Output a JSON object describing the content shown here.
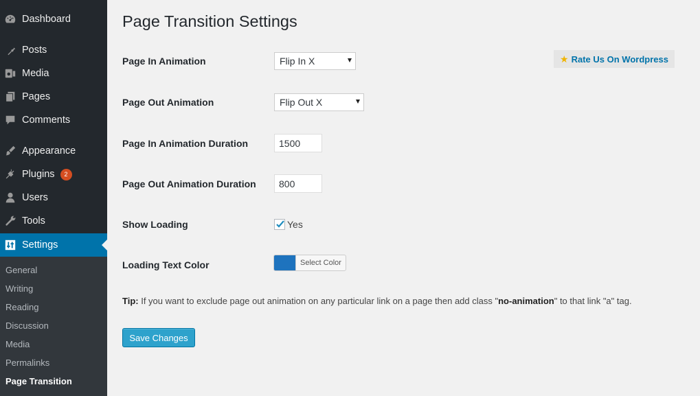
{
  "sidebar": {
    "items": [
      {
        "label": "Dashboard",
        "icon": "dashboard-icon"
      },
      {
        "label": "Posts",
        "icon": "pin-icon"
      },
      {
        "label": "Media",
        "icon": "media-icon"
      },
      {
        "label": "Pages",
        "icon": "pages-icon"
      },
      {
        "label": "Comments",
        "icon": "comment-icon"
      },
      {
        "label": "Appearance",
        "icon": "brush-icon"
      },
      {
        "label": "Plugins",
        "icon": "plug-icon",
        "badge": "2"
      },
      {
        "label": "Users",
        "icon": "user-icon"
      },
      {
        "label": "Tools",
        "icon": "wrench-icon"
      },
      {
        "label": "Settings",
        "icon": "settings-icon"
      }
    ],
    "submenu": [
      "General",
      "Writing",
      "Reading",
      "Discussion",
      "Media",
      "Permalinks",
      "Page Transition"
    ]
  },
  "page": {
    "title": "Page Transition Settings",
    "rate_label": "Rate Us On Wordpress",
    "fields": {
      "page_in_label": "Page In Animation",
      "page_in_value": "Flip In X",
      "page_out_label": "Page Out Animation",
      "page_out_value": "Flip Out X",
      "in_duration_label": "Page In Animation Duration",
      "in_duration_value": "1500",
      "out_duration_label": "Page Out Animation Duration",
      "out_duration_value": "800",
      "show_loading_label": "Show Loading",
      "show_loading_value": "Yes",
      "show_loading_checked": true,
      "color_label": "Loading Text Color",
      "color_value": "#1e73be",
      "color_button": "Select Color"
    },
    "tip": {
      "prefix": "Tip:",
      "text1": " If you want to exclude page out animation on any particular link on a page then add class \"",
      "class_name": "no-animation",
      "text2": "\" to that link \"a\" tag."
    },
    "save_label": "Save Changes"
  },
  "colors": {
    "sidebar_bg": "#23282d",
    "active": "#0073aa",
    "button": "#2ea2cc",
    "badge": "#d54e21"
  }
}
